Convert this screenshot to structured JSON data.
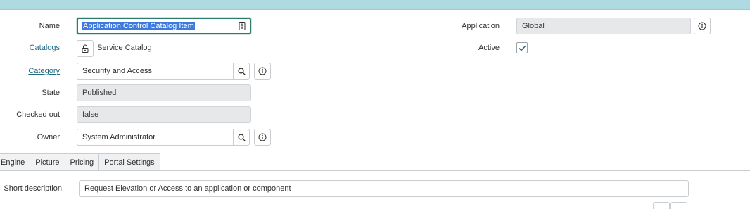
{
  "form": {
    "name_label": "Name",
    "name_value": "Application Control Catalog Item",
    "catalogs_label": "Catalogs",
    "catalogs_value": "Service Catalog",
    "category_label": "Category",
    "category_value": "Security and Access",
    "state_label": "State",
    "state_value": "Published",
    "checked_out_label": "Checked out",
    "checked_out_value": "false",
    "owner_label": "Owner",
    "owner_value": "System Administrator",
    "application_label": "Application",
    "application_value": "Global",
    "active_label": "Active",
    "active_checked": true
  },
  "tabs": [
    "Engine",
    "Picture",
    "Pricing",
    "Portal Settings"
  ],
  "description": {
    "label": "Short description",
    "value": "Request Elevation or Access to an application or component"
  },
  "colors": {
    "topbar": "#b0dae2",
    "link": "#1f6c83",
    "focus_border": "#2b7d6b",
    "selection": "#3d7ae0",
    "readonly_bg": "#e6e8ea"
  },
  "icons": [
    "field-action-icon",
    "lock-icon",
    "search-icon",
    "info-icon",
    "checkmark-icon"
  ]
}
